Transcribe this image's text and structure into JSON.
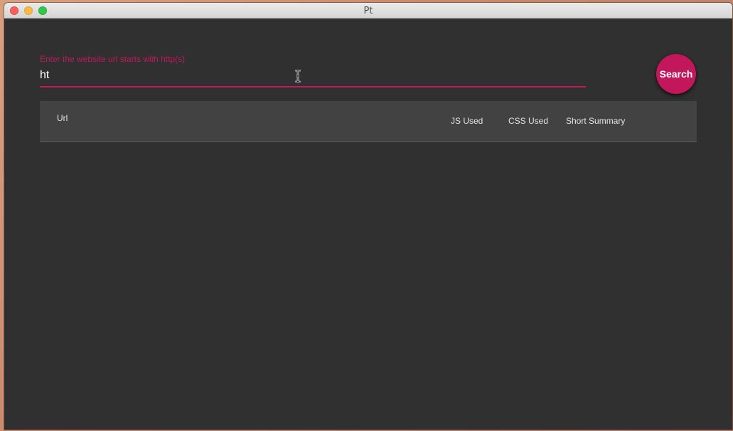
{
  "window": {
    "title": "Pt"
  },
  "url_field": {
    "label": "Enter the website url starts with http(s)",
    "value": "ht"
  },
  "search_button": {
    "label": "Search"
  },
  "table": {
    "columns": [
      "Url",
      "JS Used",
      "CSS Used",
      "Short Summary"
    ],
    "rows": []
  },
  "colors": {
    "accent": "#c2185b",
    "background": "#303030",
    "table_header": "#424242"
  }
}
